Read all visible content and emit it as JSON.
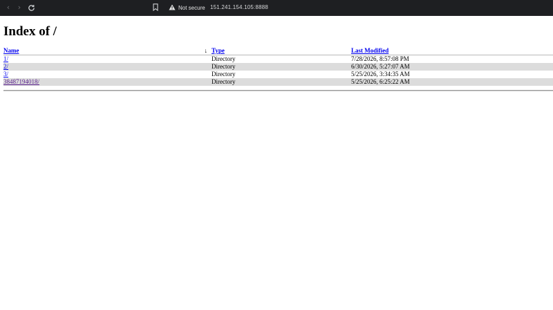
{
  "browser": {
    "security_label": "Not secure",
    "url": "151.241.154.105:8888"
  },
  "page": {
    "title": "Index of /"
  },
  "listing": {
    "headers": {
      "name": "Name",
      "sort_indicator": "↓",
      "type": "Type",
      "modified": "Last Modified"
    },
    "rows": [
      {
        "name": "1/",
        "type": "Directory",
        "modified": "7/28/2026, 8:57:08 PM"
      },
      {
        "name": "2/",
        "type": "Directory",
        "modified": "6/30/2026, 5:27:07 AM"
      },
      {
        "name": "3/",
        "type": "Directory",
        "modified": "5/25/2026, 3:34:35 AM"
      },
      {
        "name": "38487194018/",
        "type": "Directory",
        "modified": "5/25/2026, 6:25:22 AM"
      }
    ]
  }
}
